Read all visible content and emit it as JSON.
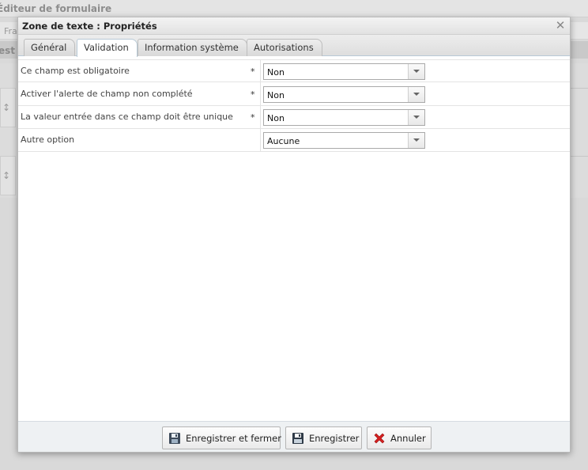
{
  "background": {
    "title": "Éditeur de formulaire",
    "toolbar_text": "Fra",
    "band_text": "est"
  },
  "dialog": {
    "title": "Zone de texte : Propriétés",
    "close_icon": "close-icon"
  },
  "tabs": [
    {
      "label": "Général",
      "active": false
    },
    {
      "label": "Validation",
      "active": true
    },
    {
      "label": "Information système",
      "active": false
    },
    {
      "label": "Autorisations",
      "active": false
    }
  ],
  "properties": [
    {
      "label": "Ce champ est obligatoire",
      "required": "*",
      "value": "Non"
    },
    {
      "label": "Activer l'alerte de champ non complété",
      "required": "*",
      "value": "Non"
    },
    {
      "label": "La valeur entrée dans ce champ doit être unique",
      "required": "*",
      "value": "Non"
    },
    {
      "label": "Autre option",
      "required": "",
      "value": "Aucune"
    }
  ],
  "buttons": {
    "save_close": {
      "label": "Enregistrer et fermer",
      "icon": "save-close-icon"
    },
    "save": {
      "label": "Enregistrer",
      "icon": "save-icon"
    },
    "cancel": {
      "label": "Annuler",
      "icon": "cancel-x-icon"
    }
  },
  "colors": {
    "cancel_red": "#d42020",
    "tab_border_active": "#b8c9d6"
  }
}
